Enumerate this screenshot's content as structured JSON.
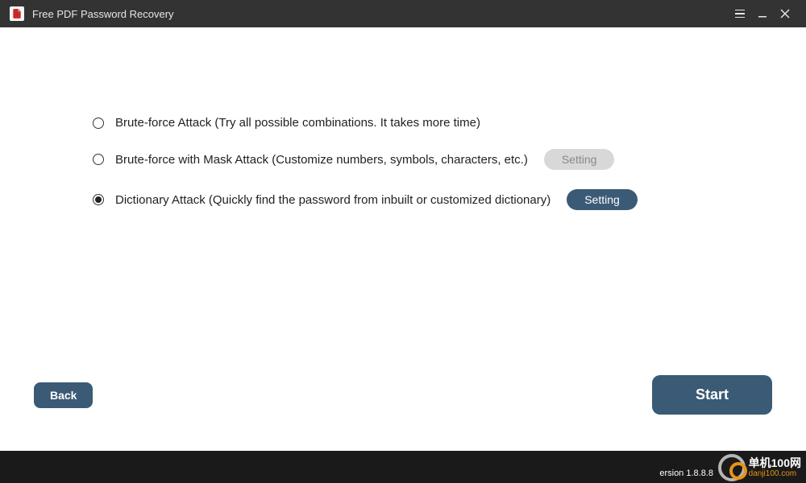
{
  "titlebar": {
    "app_title": "Free PDF Password Recovery"
  },
  "options": [
    {
      "label": "Brute-force Attack (Try all possible combinations. It takes more time)",
      "selected": false,
      "has_setting": false
    },
    {
      "label": "Brute-force with Mask Attack (Customize numbers, symbols, characters, etc.)",
      "selected": false,
      "has_setting": true,
      "setting_label": "Setting",
      "setting_enabled": false
    },
    {
      "label": "Dictionary Attack (Quickly find the password from inbuilt or customized dictionary)",
      "selected": true,
      "has_setting": true,
      "setting_label": "Setting",
      "setting_enabled": true
    }
  ],
  "footer": {
    "back_label": "Back",
    "start_label": "Start",
    "version_label": "ersion 1.8.8.8"
  },
  "watermark": {
    "line1": "单机100网",
    "line2": "danji100.com"
  }
}
